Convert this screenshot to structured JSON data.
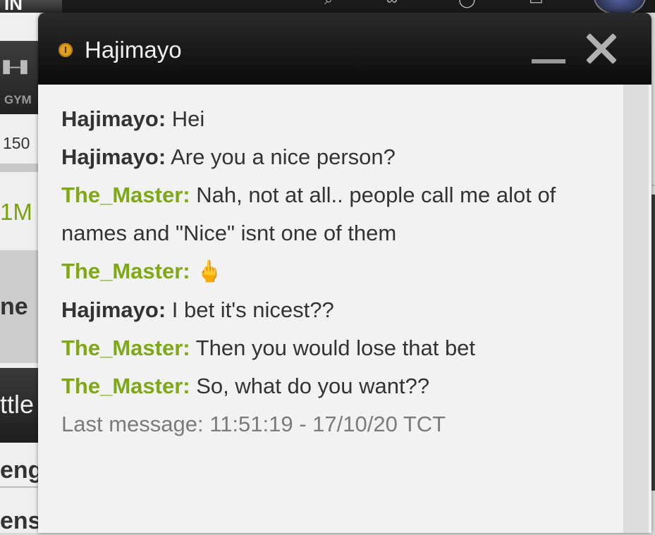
{
  "background_page": {
    "logo_text": "IN",
    "gym_label": "GYM",
    "partial_number": "150",
    "partial_value": "1M",
    "partial_text_1": "ne",
    "partial_text_2": "ttle",
    "partial_text_3": "engt",
    "partial_text_4": "ens"
  },
  "chat": {
    "title": "Hajimayo",
    "status": "idle",
    "status_color": "#e0a020",
    "self_name_color": "#7fa817",
    "messages": [
      {
        "sender": "Hajimayo:",
        "role": "other",
        "text": " Hei"
      },
      {
        "sender": "Hajimayo:",
        "role": "other",
        "text": " Are you a nice person?"
      },
      {
        "sender": "The_Master:",
        "role": "self",
        "text": " Nah, not at all.. people call me alot of names and \"Nice\" isnt one of them"
      },
      {
        "sender": "The_Master:",
        "role": "self",
        "text": " 🖕"
      },
      {
        "sender": "Hajimayo:",
        "role": "other",
        "text": " I bet it's nicest??"
      },
      {
        "sender": "The_Master:",
        "role": "self",
        "text": " Then you would lose that bet"
      },
      {
        "sender": "The_Master:",
        "role": "self",
        "text": " So, what do you want??"
      }
    ],
    "last_message": "Last message: 11:51:19 - 17/10/20 TCT"
  }
}
